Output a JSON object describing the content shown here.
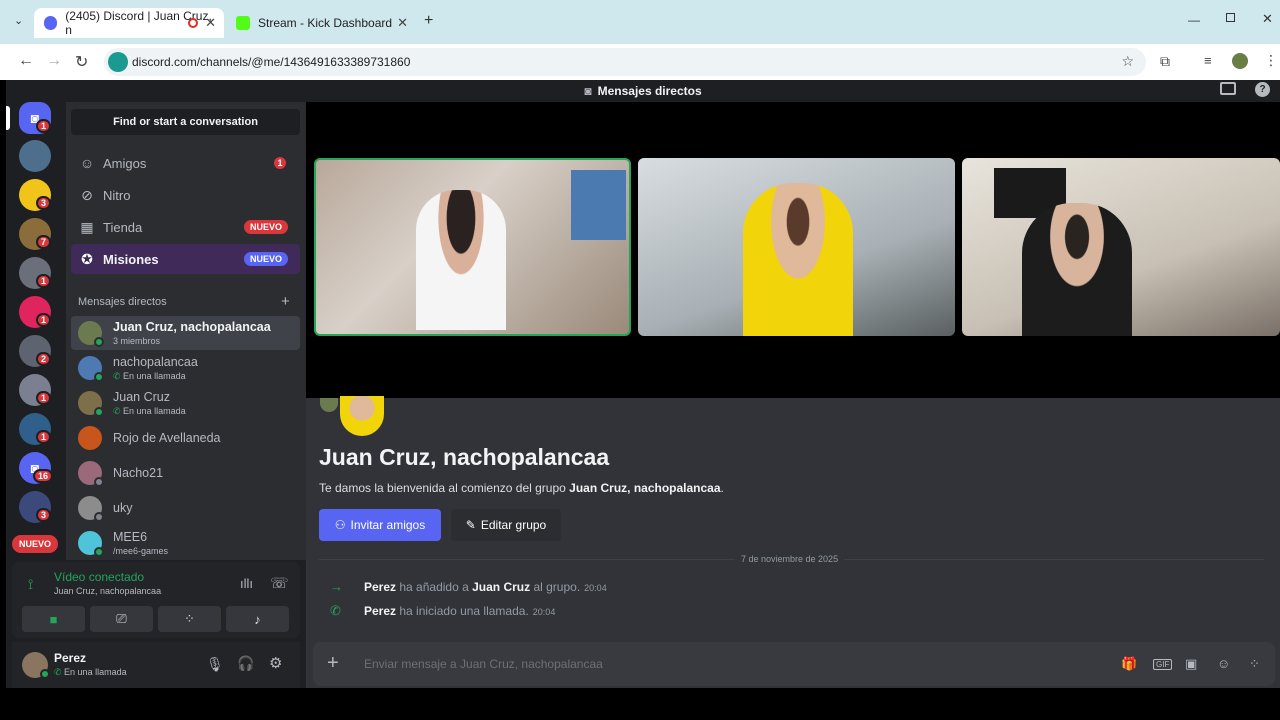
{
  "browser": {
    "tabs": [
      {
        "label": "(2405) Discord | Juan Cruz, n",
        "active": true
      },
      {
        "label": "Stream - Kick Dashboard",
        "active": false
      }
    ],
    "url": "discord.com/channels/@me/1436491633389731860"
  },
  "topbar": {
    "title": "Mensajes directos"
  },
  "rail": {
    "badges": [
      "1",
      "3",
      "7",
      "1",
      "1",
      "2",
      "1",
      "1",
      "16",
      "3"
    ],
    "nuevo": "NUEVO"
  },
  "sidebar": {
    "search_label": "Find or start a conversation",
    "nav": [
      {
        "label": "Amigos",
        "badge": "1"
      },
      {
        "label": "Nitro",
        "badge": ""
      },
      {
        "label": "Tienda",
        "badge": "NUEVO"
      },
      {
        "label": "Misiones",
        "badge": "NUEVO"
      }
    ],
    "dm_header": "Mensajes directos",
    "dms": [
      {
        "name": "Juan Cruz, nachopalancaa",
        "sub": "3 miembros"
      },
      {
        "name": "nachopalancaa",
        "sub": "En una llamada"
      },
      {
        "name": "Juan Cruz",
        "sub": "En una llamada"
      },
      {
        "name": "Rojo de Avellaneda",
        "sub": ""
      },
      {
        "name": "Nacho21",
        "sub": ""
      },
      {
        "name": "uky",
        "sub": ""
      },
      {
        "name": "MEE6",
        "sub": "/mee6-games"
      }
    ]
  },
  "voice": {
    "status": "Vídeo conectado",
    "channel": "Juan Cruz, nachopalancaa"
  },
  "user": {
    "name": "Perez",
    "status": "En una llamada"
  },
  "colors": {
    "accent": "#5865f2",
    "online": "#23a55a",
    "danger": "#da373c"
  },
  "chat": {
    "title": "Juan Cruz, nachopalancaa",
    "welcome_prefix": "Te damos la bienvenida al comienzo del grupo ",
    "welcome_group": "Juan Cruz, nachopalancaa",
    "welcome_suffix": ".",
    "invite_label": "Invitar amigos",
    "edit_label": "Editar grupo",
    "date_divider": "7 de noviembre de 2025",
    "messages": [
      {
        "actor": "Perez",
        "text": " ha añadido a ",
        "target": "Juan Cruz",
        "text2": " al grupo.",
        "time": "20:04"
      },
      {
        "actor": "Perez",
        "text": " ha iniciado una llamada.",
        "target": "",
        "text2": "",
        "time": "20:04"
      }
    ],
    "composer_placeholder": "Enviar mensaje a Juan Cruz, nachopalancaa"
  }
}
